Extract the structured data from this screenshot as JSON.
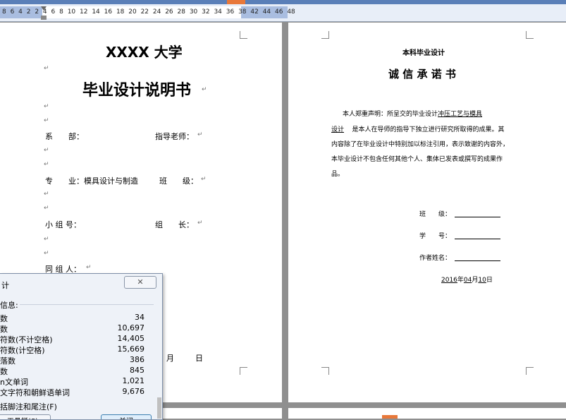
{
  "ruler": {
    "numbers": "8 6 4 2  2 4 6 8 10 12 14 16 18 20 22 24 26 28 30 32 34 36 38   42 44 46 48"
  },
  "page1": {
    "university": "XXXX 大学",
    "doc_title": "毕业设计说明书",
    "dept_label": "系　　部：",
    "advisor_label": "指导老师：",
    "major_label": "专　　业：模具设计与制造",
    "class_label": "班　　级：",
    "group_no_label": "小 组 号：",
    "leader_label": "组　　长：",
    "member_label": "同 组 人：",
    "date_month": "月",
    "date_day": "日",
    "para_mark": "↵"
  },
  "page2": {
    "header": "本科毕业设计",
    "title": "诚 信 承 诺 书",
    "body_line1": "本人郑重声明：所呈交的毕业设计",
    "body_link1": "冲压工艺与模具",
    "body_link2": "设计",
    "body_line2": "是本人在导师的指导下独立进行研究所取得的成果。其",
    "body_line3": "内容除了在毕业设计中特别加以标注引用，表示致谢的内容外，",
    "body_line4": "本毕业设计不包含任何其他个人、集体已发表或撰写的成果作",
    "body_line5": "品。",
    "class_label": "班　　级：",
    "number_label": "学　　号：",
    "sign_label": "作者姓名：",
    "year": "2016",
    "year_label": "年",
    "month": "04",
    "month_label": "月",
    "day": "10",
    "day_label": "日"
  },
  "dialog": {
    "title": "计",
    "close_glyph": "✕",
    "group_label": "信息:",
    "stats": [
      {
        "label": "数",
        "value": "34"
      },
      {
        "label": "数",
        "value": "10,697"
      },
      {
        "label": "符数(不计空格)",
        "value": "14,405"
      },
      {
        "label": "符数(计空格)",
        "value": "15,669"
      },
      {
        "label": "落数",
        "value": "386"
      },
      {
        "label": "数",
        "value": "845"
      },
      {
        "label": "n文单词",
        "value": "1,021"
      },
      {
        "label": "文字符和朝鲜语单词",
        "value": "9,676"
      }
    ],
    "checkbox_label": "括脚注和尾注(F)",
    "toolbar_button": "工具栏(S)",
    "close_button": "关闭"
  },
  "colors": {
    "ruler_bg": "#e8eef8",
    "ruler_shade": "#a9bde0",
    "dialog_bg": "#eef2f8",
    "workspace": "#8f8f8f"
  }
}
